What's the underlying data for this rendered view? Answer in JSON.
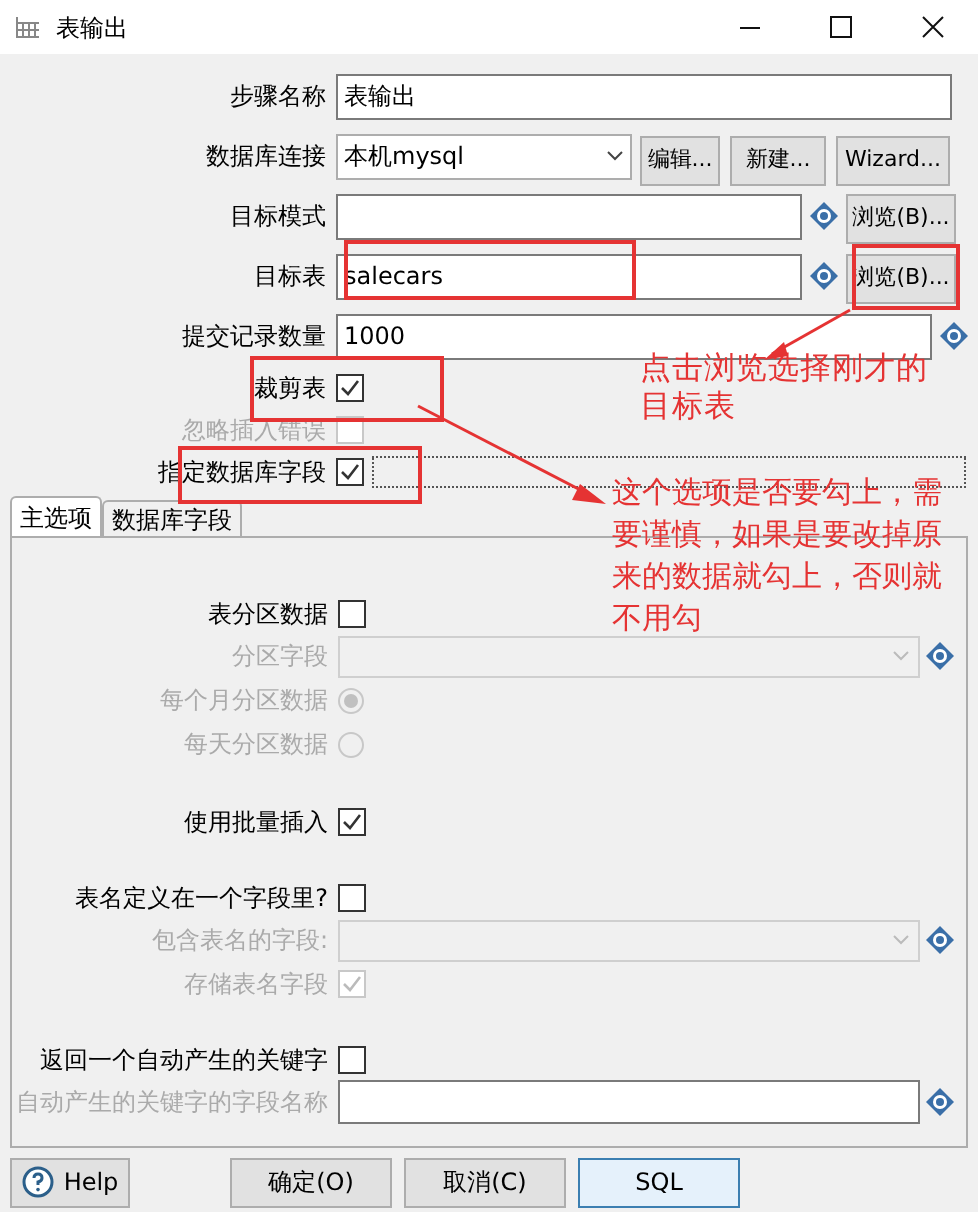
{
  "window": {
    "title": "表输出"
  },
  "fields": [
    {
      "kind": "text",
      "label": "步骤名称",
      "value": "表输出"
    },
    {
      "kind": "select",
      "label": "数据库连接",
      "value": "本机mysql",
      "buttons": [
        "编辑...",
        "新建...",
        "Wizard..."
      ]
    },
    {
      "kind": "text",
      "label": "目标模式",
      "variable": true,
      "buttons": [
        "浏览(B)..."
      ]
    },
    {
      "kind": "text",
      "label": "目标表",
      "value": "salecars",
      "variable": true,
      "buttons": [
        "浏览(B)..."
      ]
    },
    {
      "kind": "text",
      "label": "提交记录数量",
      "value": "1000",
      "variable": true
    },
    {
      "kind": "checkbox",
      "label": "裁剪表",
      "checked": true,
      "disabled": false
    },
    {
      "kind": "checkbox",
      "label": "忽略插入错误",
      "checked": false,
      "disabled": true
    },
    {
      "kind": "checkbox",
      "label": "指定数据库字段",
      "checked": true,
      "disabled": false
    }
  ],
  "tabs": [
    {
      "label": "主选项",
      "selected": true
    },
    {
      "label": "数据库字段",
      "selected": false
    }
  ],
  "option_groups": [
    [
      {
        "kind": "checkbox",
        "label": "表分区数据",
        "checked": false,
        "disabled": false
      },
      {
        "kind": "select",
        "label": "分区字段",
        "disabled": true,
        "variable": true
      },
      {
        "kind": "radio",
        "label": "每个月分区数据",
        "selected": true,
        "disabled": true
      },
      {
        "kind": "radio",
        "label": "每天分区数据",
        "selected": false,
        "disabled": true
      }
    ],
    [
      {
        "kind": "checkbox",
        "label": "使用批量插入",
        "checked": true,
        "disabled": false
      }
    ],
    [
      {
        "kind": "checkbox",
        "label": "表名定义在一个字段里?",
        "checked": false,
        "disabled": false
      },
      {
        "kind": "select",
        "label": "包含表名的字段:",
        "disabled": true,
        "variable": true
      },
      {
        "kind": "checkbox",
        "label": "存储表名字段",
        "checked": true,
        "disabled": true
      }
    ],
    [
      {
        "kind": "checkbox",
        "label": "返回一个自动产生的关键字",
        "checked": false,
        "disabled": false
      },
      {
        "kind": "text",
        "label": "自动产生的关键字的字段名称",
        "disabled": true,
        "variable": true
      }
    ]
  ],
  "buttons": [
    {
      "kind": "help",
      "label": "Help"
    },
    {
      "kind": "plain",
      "label": "确定(O)"
    },
    {
      "kind": "plain",
      "label": "取消(C)"
    },
    {
      "kind": "default",
      "label": "SQL"
    }
  ],
  "annotations": [
    "点击浏览选择刚才的目标表",
    "这个选项是否要勾上，需要谨慎，如果是要改掉原来的数据就勾上，否则就不用勾"
  ]
}
